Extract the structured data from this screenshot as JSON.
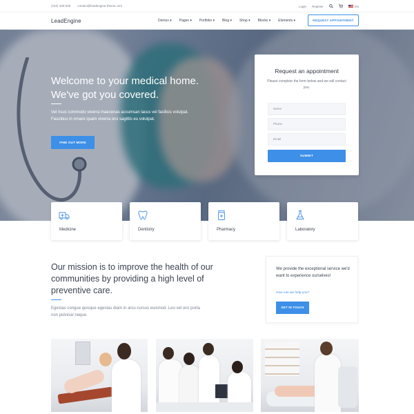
{
  "topbar": {
    "phone": "(222) 400-630",
    "email": "contact@leadengine-theme.com",
    "login": "Login",
    "register": "Register",
    "search_icon": "search-icon",
    "cart_icon": "cart-icon",
    "language": "EN"
  },
  "header": {
    "logo": "LeadEngine",
    "nav": [
      "Demos",
      "Pages",
      "Portfolio",
      "Blog",
      "Shop",
      "Blocks",
      "Elements"
    ],
    "cta": "REQUEST APPOINTMENT"
  },
  "hero": {
    "title_line1": "Welcome to your medical home.",
    "title_line2": "We've got you covered.",
    "text": "Vel risus commodo viverra maecenas accumsan lacus vel facilisis volutpat. Faucibus in ornare quam viverra orci sagittis eu volutpat.",
    "button": "FIND OUT MORE"
  },
  "form": {
    "title": "Request an appointment",
    "subtitle": "Please complete the form below and we will contact you.",
    "name_placeholder": "Name",
    "phone_placeholder": "Phone",
    "email_placeholder": "Email",
    "submit": "SUBMIT"
  },
  "features": [
    {
      "label": "Medicine",
      "icon": "ambulance-icon"
    },
    {
      "label": "Dentistry",
      "icon": "tooth-icon"
    },
    {
      "label": "Pharmacy",
      "icon": "pill-bottle-icon"
    },
    {
      "label": "Laboratory",
      "icon": "flask-icon"
    }
  ],
  "mission": {
    "title": "Our mission is to improve the health of our communities by providing a high level of preventive care.",
    "text": "Egestas congue quisque egestas diam in arcu cursus euismod. Leo vel orci porta non pulvinar neque."
  },
  "help": {
    "text": "We provide the exceptional service we'd want to experience ourselves!",
    "link": "How can we help you?",
    "button": "GET IN TOUCH"
  },
  "colors": {
    "accent": "#3d8fe8",
    "text_dark": "#3a4250",
    "hero_overlay": "#2d3a52"
  }
}
